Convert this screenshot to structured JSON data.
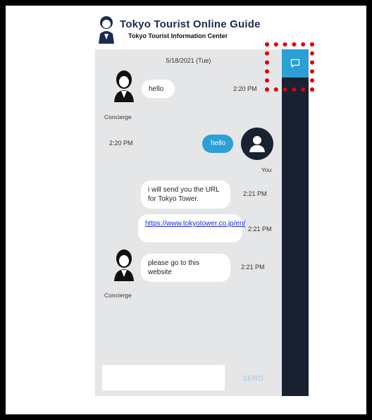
{
  "header": {
    "title": "Tokyo Tourist Online Guide",
    "subtitle": "Tokyo Tourist Information Center"
  },
  "chat": {
    "date": "5/18/2021 (Tue)",
    "messages": [
      {
        "sender": "Concierge",
        "text": "hello",
        "time": "2:20 PM"
      },
      {
        "sender": "You",
        "text": "hello",
        "time": "2:20 PM"
      },
      {
        "sender": "Concierge",
        "text": "i will send you the URL for Tokyo Tower.",
        "time": "2:21 PM"
      },
      {
        "sender": "Concierge",
        "text": "https://www.tokyotower.co.jp/en/",
        "time": "2:21 PM"
      },
      {
        "sender": "Concierge",
        "text": "please go to this website",
        "time": "2:21 PM"
      }
    ]
  },
  "composer": {
    "input_value": "",
    "send_label": "SEND"
  },
  "sidebar": {
    "chat_icon": "chat-bubble-icon"
  }
}
